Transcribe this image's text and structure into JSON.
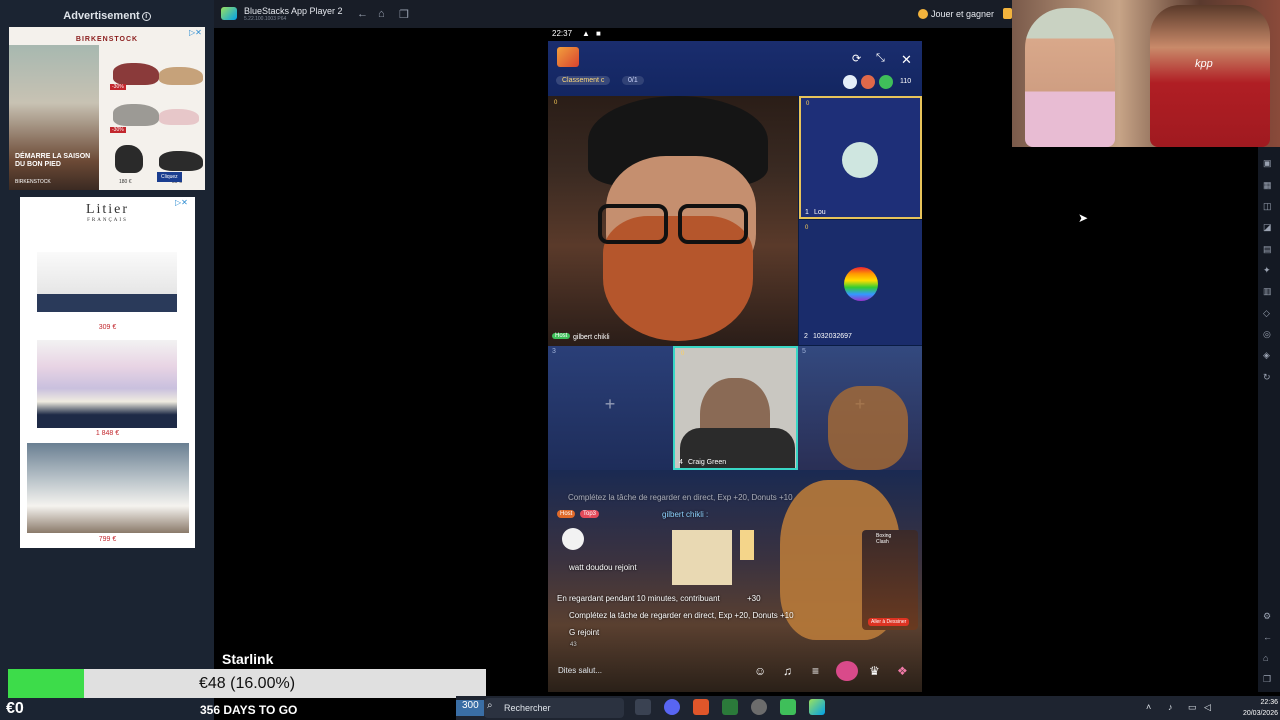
{
  "ads": {
    "header": "Advertisement",
    "ad1": {
      "brand": "BIRKENSTOCK",
      "slogan": "DÉMARRE LA SAISON DU BON PIED",
      "brand_footer": "BIRKENSTOCK",
      "discount1": "-30%",
      "discount2": "-30%",
      "price1": "180 €",
      "price2": "50 €",
      "cta": "Cliquez"
    },
    "ad2": {
      "brand": "Litier",
      "brand_sub": "FRANÇAIS",
      "price1": "309 €",
      "price2": "1 848 €",
      "price3": "799 €"
    }
  },
  "emulator": {
    "title": "BlueStacks App Player 2",
    "subtitle": "5.22.100.1003 P64",
    "earn_label": "Jouer et gagner"
  },
  "phone": {
    "status_time": "22:37",
    "room": {
      "rank_pill": "Classement c",
      "tasks_pill": "0/1",
      "viewer_count": "110"
    },
    "tiles": [
      {
        "index": "",
        "name": "gilbert chikli",
        "badge": "0",
        "role": "Host"
      },
      {
        "index": "1",
        "name": "Lou",
        "badge": "0"
      },
      {
        "index": "2",
        "name": "1032032697",
        "badge": "0"
      },
      {
        "index": "3",
        "name": "",
        "badge": ""
      },
      {
        "index": "4",
        "name": "Craig Green",
        "badge": "0"
      },
      {
        "index": "5",
        "name": "",
        "badge": ""
      }
    ],
    "chat": [
      "Complétez la tâche de regarder en direct, Exp +20, Donuts +10",
      "gilbert chikli :",
      "watt doudou rejoint",
      "En regardant pendant 10 minutes, contribuant",
      "+30",
      "Complétez la tâche de regarder en direct, Exp +20, Donuts +10",
      "G rejoint"
    ],
    "chat_tags": {
      "host": "Host",
      "top": "Top3"
    },
    "chat_count": "43",
    "input_placeholder": "Dites salut...",
    "side_game": {
      "label": "Boxing Clash",
      "button": "Aller à Dessiner"
    }
  },
  "stream": {
    "label": "Starlink",
    "goal_text": "€48 (16.00%)",
    "goal_progress": 0.16,
    "current": "€0",
    "days_label": "356 DAYS TO GO"
  },
  "taskbar": {
    "weather": "300",
    "search_placeholder": "Rechercher",
    "time": "22:36",
    "date": "20/03/2026"
  },
  "webcam": {
    "shirt_text": "kpp"
  }
}
